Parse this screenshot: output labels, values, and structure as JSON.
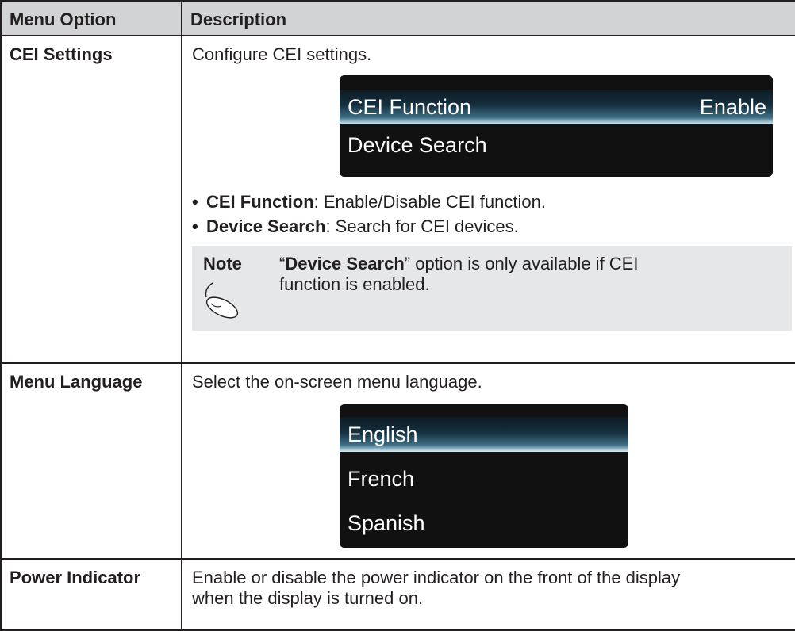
{
  "headers": {
    "option": "Menu Option",
    "description": "Description"
  },
  "cei": {
    "label": "CEI Settings",
    "intro": "Configure CEI settings.",
    "osd": {
      "row1_label": "CEI Function",
      "row1_value": "Enable",
      "row2_label": "Device Search"
    },
    "bullets": [
      {
        "term": "CEI Function",
        "text": ": Enable/Disable CEI function."
      },
      {
        "term": "Device Search",
        "text": ": Search for CEI devices."
      }
    ],
    "note": {
      "label": "Note",
      "quote_open": "“",
      "term": "Device Search",
      "line1_rest": "” option is only available if CEI",
      "line2": "function is enabled."
    }
  },
  "language": {
    "label": "Menu Language",
    "intro": "Select the on-screen menu language.",
    "options": [
      "English",
      "French",
      "Spanish"
    ]
  },
  "power": {
    "label": "Power Indicator",
    "line1": "Enable or disable the power indicator on the front of the display",
    "line2": "when the display is turned on."
  },
  "colors": {
    "header_bg": "#d1d3d4",
    "note_bg": "#e6e7e8",
    "osd_bg": "#111111",
    "osd_highlight": "#3e6e85"
  },
  "icons": {
    "note": "mouse-icon"
  }
}
